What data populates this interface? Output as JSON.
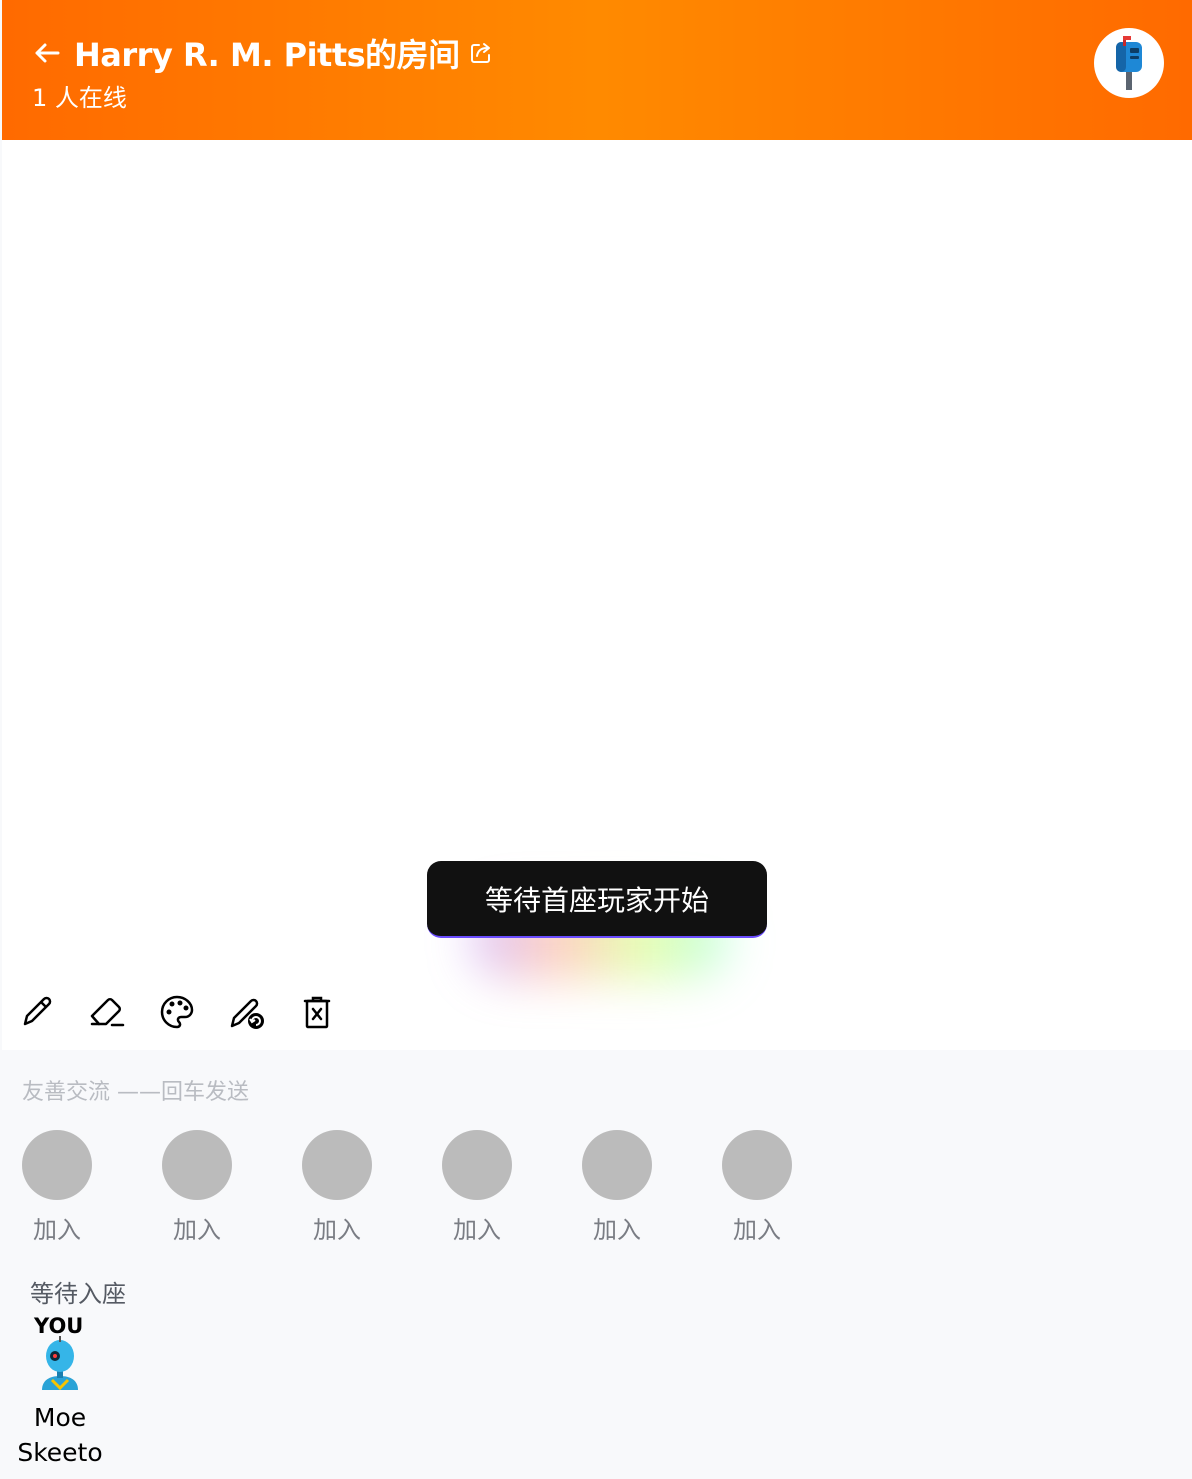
{
  "header": {
    "back_icon": "arrow-left-icon",
    "room_title": "Harry R. M. Pitts的房间",
    "share_icon": "share-icon",
    "online_count": "1 人在线",
    "avatar_icon": "mailbox-avatar-icon"
  },
  "canvas": {
    "status_message": "等待首座玩家开始"
  },
  "toolbar": {
    "tools": [
      {
        "icon": "pencil-icon"
      },
      {
        "icon": "eraser-icon"
      },
      {
        "icon": "palette-icon"
      },
      {
        "icon": "pen-undo-icon"
      },
      {
        "icon": "trash-icon"
      }
    ]
  },
  "chat": {
    "placeholder": "友善交流 ——回车发送"
  },
  "seats": [
    {
      "label": "加入"
    },
    {
      "label": "加入"
    },
    {
      "label": "加入"
    },
    {
      "label": "加入"
    },
    {
      "label": "加入"
    },
    {
      "label": "加入"
    }
  ],
  "waiting": {
    "title": "等待入座",
    "badge": "YOU",
    "player_name": "Moe Skeeto",
    "avatar_icon": "robot-avatar-icon"
  },
  "colors": {
    "header_orange": "#ff7a00",
    "seat_gray": "#bbbbbb",
    "pill_black": "#111111"
  }
}
